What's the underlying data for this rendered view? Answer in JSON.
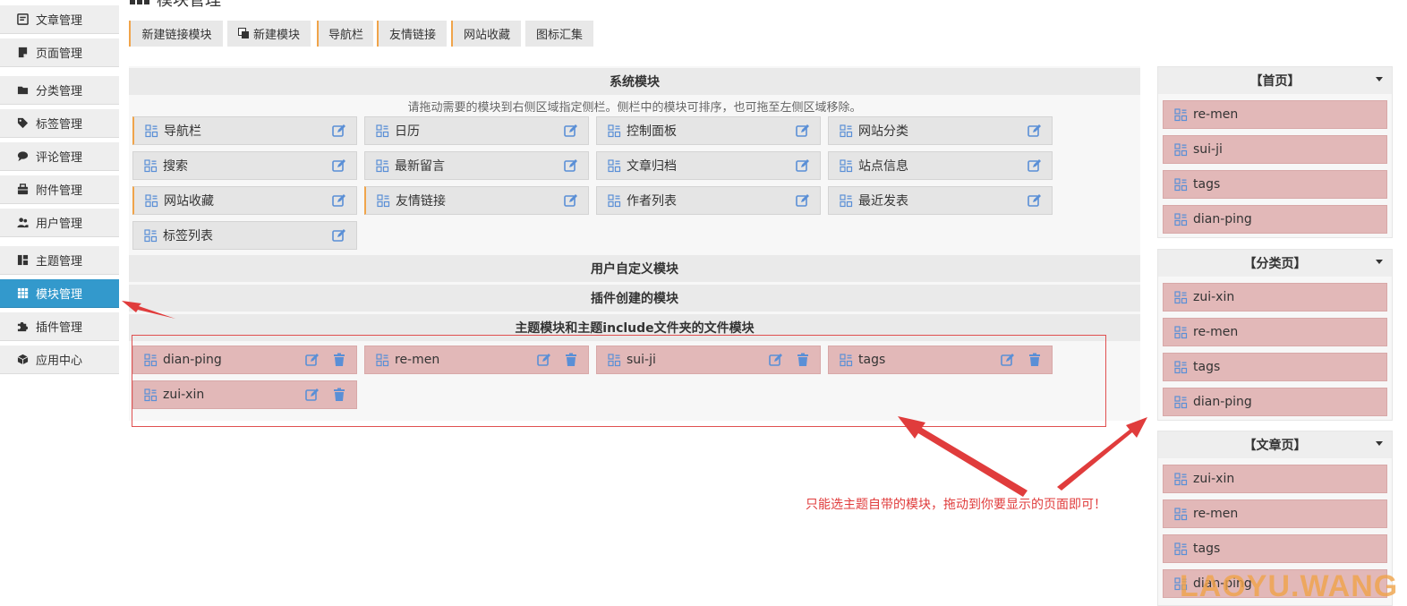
{
  "sidebar": {
    "items": [
      {
        "label": "文章管理",
        "icon": "article-icon"
      },
      {
        "label": "页面管理",
        "icon": "page-icon"
      },
      {
        "label": "分类管理",
        "icon": "folder-icon"
      },
      {
        "label": "标签管理",
        "icon": "tag-icon"
      },
      {
        "label": "评论管理",
        "icon": "comment-icon"
      },
      {
        "label": "附件管理",
        "icon": "attachment-icon"
      },
      {
        "label": "用户管理",
        "icon": "users-icon"
      },
      {
        "label": "主题管理",
        "icon": "theme-icon"
      },
      {
        "label": "模块管理",
        "icon": "grid-icon",
        "active": true
      },
      {
        "label": "插件管理",
        "icon": "puzzle-icon"
      },
      {
        "label": "应用中心",
        "icon": "cube-icon"
      }
    ]
  },
  "page": {
    "title": "模块管理"
  },
  "toolbar": {
    "buttons": [
      {
        "label": "新建链接模块"
      },
      {
        "label": "新建模块",
        "icon": "copy-icon"
      },
      {
        "label": "导航栏"
      },
      {
        "label": "友情链接"
      },
      {
        "label": "网站收藏"
      },
      {
        "label": "图标汇集"
      }
    ]
  },
  "sections": {
    "system": "系统模块",
    "system_note": "请拖动需要的模块到右侧区域指定侧栏。侧栏中的模块可排序，也可拖至左侧区域移除。",
    "user_defined": "用户自定义模块",
    "plugin_created": "插件创建的模块",
    "theme_modules": "主题模块和主题include文件夹的文件模块"
  },
  "system_modules": [
    {
      "label": "导航栏",
      "marked": true
    },
    {
      "label": "日历"
    },
    {
      "label": "控制面板"
    },
    {
      "label": "网站分类"
    },
    {
      "label": "搜索"
    },
    {
      "label": "最新留言"
    },
    {
      "label": "文章归档"
    },
    {
      "label": "站点信息"
    },
    {
      "label": "网站收藏",
      "marked": true
    },
    {
      "label": "友情链接",
      "marked": true
    },
    {
      "label": "作者列表"
    },
    {
      "label": "最近发表"
    },
    {
      "label": "标签列表"
    }
  ],
  "theme_modules": [
    "dian-ping",
    "re-men",
    "sui-ji",
    "tags",
    "zui-xin"
  ],
  "side_boxes": [
    {
      "title": "【首页】",
      "items": [
        "re-men",
        "sui-ji",
        "tags",
        "dian-ping"
      ]
    },
    {
      "title": "【分类页】",
      "items": [
        "zui-xin",
        "re-men",
        "tags",
        "dian-ping"
      ]
    },
    {
      "title": "【文章页】",
      "items": [
        "zui-xin",
        "re-men",
        "tags",
        "dian-ping"
      ]
    }
  ],
  "annotation": "只能选主题自带的模块，拖动到你要显示的页面即可！",
  "watermark": "LAOYU.WANG",
  "colors": {
    "accent_blue": "#3399cc",
    "marker_orange": "#f0a44a",
    "theme_module_pink": "#e2b8b8",
    "annotation_red": "#e03c3c",
    "icon_blue": "#5a8fd6"
  }
}
